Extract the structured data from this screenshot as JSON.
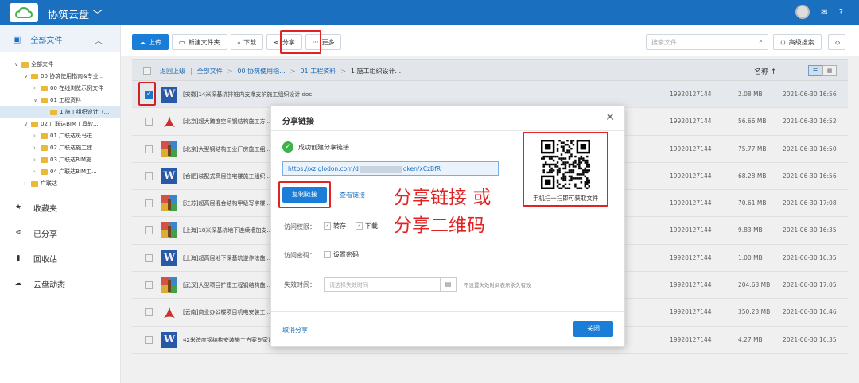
{
  "app": {
    "title": "协筑云盘",
    "accent": "#1a7ed8",
    "header_color": "#1a6fbf",
    "highlight_color": "#e02424"
  },
  "sidebar": {
    "head_label": "全部文件",
    "tree": [
      {
        "label": "全部文件",
        "depth": 0,
        "expanded": true
      },
      {
        "label": "00 协筑使用指南&专业...",
        "depth": 1,
        "expanded": true
      },
      {
        "label": "00 在线浏览示例文件",
        "depth": 2,
        "expanded": false
      },
      {
        "label": "01 工程资料",
        "depth": 2,
        "expanded": true
      },
      {
        "label": "1.施工组织设计（...",
        "depth": 3,
        "selected": true
      },
      {
        "label": "02 广联达BIM工具软...",
        "depth": 1,
        "expanded": true
      },
      {
        "label": "01 广联达斑马进...",
        "depth": 2,
        "expanded": false
      },
      {
        "label": "02 广联达施工建...",
        "depth": 2,
        "expanded": false
      },
      {
        "label": "03 广联达BIM施...",
        "depth": 2,
        "expanded": false
      },
      {
        "label": "04 广联达BIM工...",
        "depth": 2,
        "expanded": false
      },
      {
        "label": "广联达",
        "depth": 1,
        "expanded": false
      }
    ],
    "nav": [
      {
        "label": "收藏夹",
        "icon": "star-icon"
      },
      {
        "label": "已分享",
        "icon": "share-icon"
      },
      {
        "label": "回收站",
        "icon": "trash-icon"
      },
      {
        "label": "云盘动态",
        "icon": "cloud-icon"
      }
    ]
  },
  "toolbar": {
    "upload": "上传",
    "new_folder": "新建文件夹",
    "download": "下载",
    "share": "分享",
    "more": "更多",
    "search_placeholder": "搜索文件",
    "advanced_search": "高级搜索"
  },
  "breadcrumb": {
    "back": "返回上级",
    "items": [
      "全部文件",
      "00 协筑使用指...",
      "01 工程资料"
    ],
    "current": "1.施工组织设计...",
    "sort_label": "名称 ↑"
  },
  "files": [
    {
      "type": "word",
      "name": "[安徽]14米深基坑排桩内支撑支护施工组织设计.doc",
      "owner": "19920127144",
      "size": "2.08 MB",
      "date": "2021-06-30 16:56",
      "checked": true
    },
    {
      "type": "pdf",
      "name": "[北京]超大跨度空间钢结构施工方...",
      "owner": "19920127144",
      "size": "56.66 MB",
      "date": "2021-06-30 16:52",
      "checked": false
    },
    {
      "type": "archive",
      "name": "[北京]大型钢结构工业厂房施工组...",
      "owner": "19920127144",
      "size": "75.77 MB",
      "date": "2021-06-30 16:50",
      "checked": false
    },
    {
      "type": "word",
      "name": "[合肥]装配式高层住宅楼施工组织...",
      "owner": "19920127144",
      "size": "68.28 MB",
      "date": "2021-06-30 16:56",
      "checked": false
    },
    {
      "type": "archive",
      "name": "[江苏]超高层混合结构甲级写字楼...",
      "owner": "19920127144",
      "size": "70.61 MB",
      "date": "2021-06-30 17:08",
      "checked": false
    },
    {
      "type": "archive",
      "name": "[上海]18米深基坑地下连续墙加支...",
      "owner": "19920127144",
      "size": "9.83 MB",
      "date": "2021-06-30 16:35",
      "checked": false
    },
    {
      "type": "word",
      "name": "[上海]超高层地下深基坑逆作法施...",
      "owner": "19920127144",
      "size": "1.00 MB",
      "date": "2021-06-30 16:35",
      "checked": false
    },
    {
      "type": "archive",
      "name": "[武汉]大型项目扩建工程钢结构施...",
      "owner": "19920127144",
      "size": "204.63 MB",
      "date": "2021-06-30 17:05",
      "checked": false
    },
    {
      "type": "pdf",
      "name": "[云南]商业办公楼项目机电安装工...",
      "owner": "19920127144",
      "size": "350.23 MB",
      "date": "2021-06-30 16:46",
      "checked": false
    },
    {
      "type": "word",
      "name": "42米跨度钢结构安装施工方案专家论证版.doc",
      "owner": "19920127144",
      "size": "4.27 MB",
      "date": "2021-06-30 16:35",
      "checked": false
    }
  ],
  "dialog": {
    "title": "分享链接",
    "success_text": "成功创建分享链接",
    "link_prefix": "https://xz.glodon.com/d",
    "link_suffix": "oken/xCzBfR",
    "copy_button": "复制链接",
    "view_link": "查看链接",
    "qr_caption": "手机扫一扫即可获取文件",
    "permission_label": "访问权限：",
    "perm_transfer": "转存",
    "perm_download": "下载",
    "password_label": "访问密码：",
    "set_password": "设置密码",
    "expiry_label": "失效时间：",
    "expiry_placeholder": "请选择失效时间",
    "expiry_hint": "不设置失效时间表示永久有效",
    "cancel_share": "取消分享",
    "close_button": "关闭"
  },
  "annotation": {
    "line1": "分享链接 或",
    "line2": "分享二维码"
  }
}
